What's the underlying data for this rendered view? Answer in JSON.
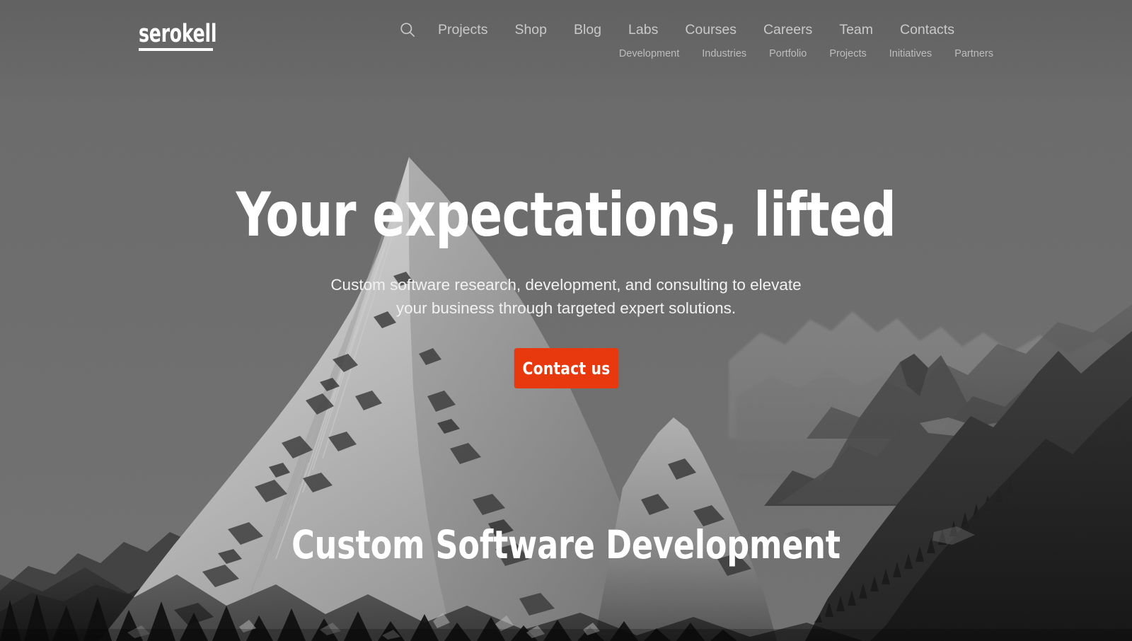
{
  "brand": {
    "logo_text": "serokell",
    "accent_color": "#e8380d",
    "sky_color": "#6d6d6d"
  },
  "header": {
    "search_icon": "search-icon",
    "primary_nav": [
      {
        "label": "Projects"
      },
      {
        "label": "Shop"
      },
      {
        "label": "Blog"
      },
      {
        "label": "Labs"
      },
      {
        "label": "Courses"
      },
      {
        "label": "Careers"
      },
      {
        "label": "Team"
      },
      {
        "label": "Contacts"
      }
    ],
    "secondary_nav": [
      {
        "label": "Development"
      },
      {
        "label": "Industries"
      },
      {
        "label": "Portfolio"
      },
      {
        "label": "Projects"
      },
      {
        "label": "Initiatives"
      },
      {
        "label": "Partners"
      }
    ]
  },
  "hero": {
    "title": "Your expectations, lifted",
    "subtitle": "Custom software research, development, and consulting to elevate your business through targeted expert solutions.",
    "cta_label": "Contact us",
    "background_alt": "grayscale-mountain-range-photo"
  },
  "section": {
    "heading": "Custom Software Development"
  }
}
